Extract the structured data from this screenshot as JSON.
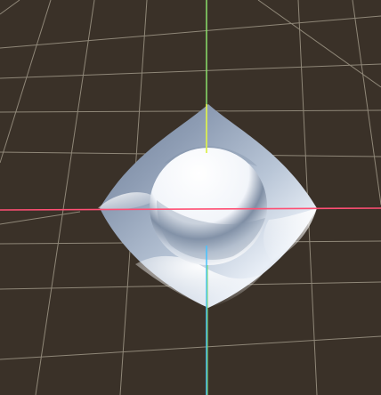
{
  "viewport": {
    "background_color": "#3a3128",
    "grid_color": "#8f8778",
    "x_axis_color": "#ff4f74",
    "y_axis_color": "#d8ef4a",
    "z_axis_color": "#46c3ff",
    "object": {
      "outer_shell_color": "#d7e0ef",
      "inner_sphere_color": "#f4f7fb"
    }
  }
}
